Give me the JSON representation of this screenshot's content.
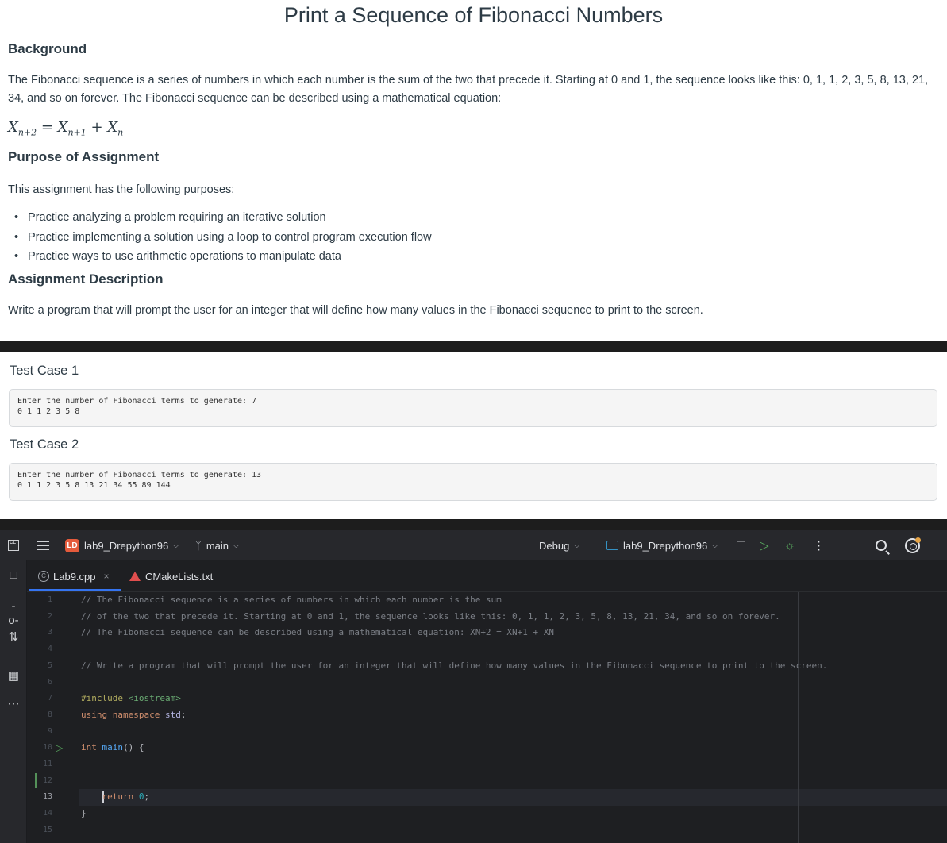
{
  "assignment": {
    "title": "Print a Sequence of Fibonacci Numbers",
    "background_heading": "Background",
    "background_text": "The Fibonacci sequence is a series of numbers in which each number is the sum of the two that precede it. Starting at 0 and 1, the sequence looks like this: 0, 1, 1, 2, 3, 5, 8, 13, 21, 34, and so on forever. The Fibonacci sequence can be described using a mathematical equation:",
    "equation": {
      "lhs": "X",
      "lhs_sub": "n+2",
      "eq": " = ",
      "t1": "X",
      "t1_sub": "n+1",
      "plus": " + ",
      "t2": "X",
      "t2_sub": "n"
    },
    "purpose_heading": "Purpose of Assignment",
    "purpose_intro": "This assignment has the following purposes:",
    "purposes": [
      "Practice analyzing a problem requiring an iterative solution",
      "Practice implementing a solution using a loop to control program execution flow",
      "Practice ways to use arithmetic operations to manipulate data"
    ],
    "description_heading": "Assignment Description",
    "description_text": "Write a program that will prompt the user for an integer that will define how many values in the Fibonacci sequence to print to the screen."
  },
  "test_cases": [
    {
      "title": "Test Case 1",
      "lines": [
        "Enter the number of Fibonacci terms to generate: 7",
        "0 1 1 2 3 5 8"
      ]
    },
    {
      "title": "Test Case 2",
      "lines": [
        "Enter the number of Fibonacci terms to generate: 13",
        "0 1 1 2 3 5 8 13 21 34 55 89 144"
      ]
    }
  ],
  "ide": {
    "logo": "CL",
    "project_badge": "LD",
    "project_name": "lab9_Drepython96",
    "branch": "main",
    "build_mode": "Debug",
    "run_config": "lab9_Drepython96",
    "tabs": [
      {
        "label": "Lab9.cpp",
        "close": "×",
        "active": true
      },
      {
        "label": "CMakeLists.txt",
        "active": false
      }
    ],
    "current_line": 13,
    "run_gutter_line": 10,
    "line_numbers": [
      "1",
      "2",
      "3",
      "4",
      "5",
      "6",
      "7",
      "8",
      "9",
      "10",
      "11",
      "12",
      "13",
      "14",
      "15"
    ],
    "code": {
      "l1": "// The Fibonacci sequence is a series of numbers in which each number is the sum",
      "l2": "// of the two that precede it. Starting at 0 and 1, the sequence looks like this: 0, 1, 1, 2, 3, 5, 8, 13, 21, 34, and so on forever.",
      "l3": "// The Fibonacci sequence can be described using a mathematical equation: XN+2 = XN+1 + XN",
      "l5": "// Write a program that will prompt the user for an integer that will define how many values in the Fibonacci sequence to print to the screen.",
      "l7_dir": "#include ",
      "l7_hdr": "<iostream>",
      "l8_kw": "using namespace",
      "l8_ns": " std",
      "l8_end": ";",
      "l10_kw": "int",
      "l10_fn": " main",
      "l10_end": "() {",
      "l13_kw": "return",
      "l13_num": " 0",
      "l13_end": ";",
      "l14": "}"
    }
  }
}
